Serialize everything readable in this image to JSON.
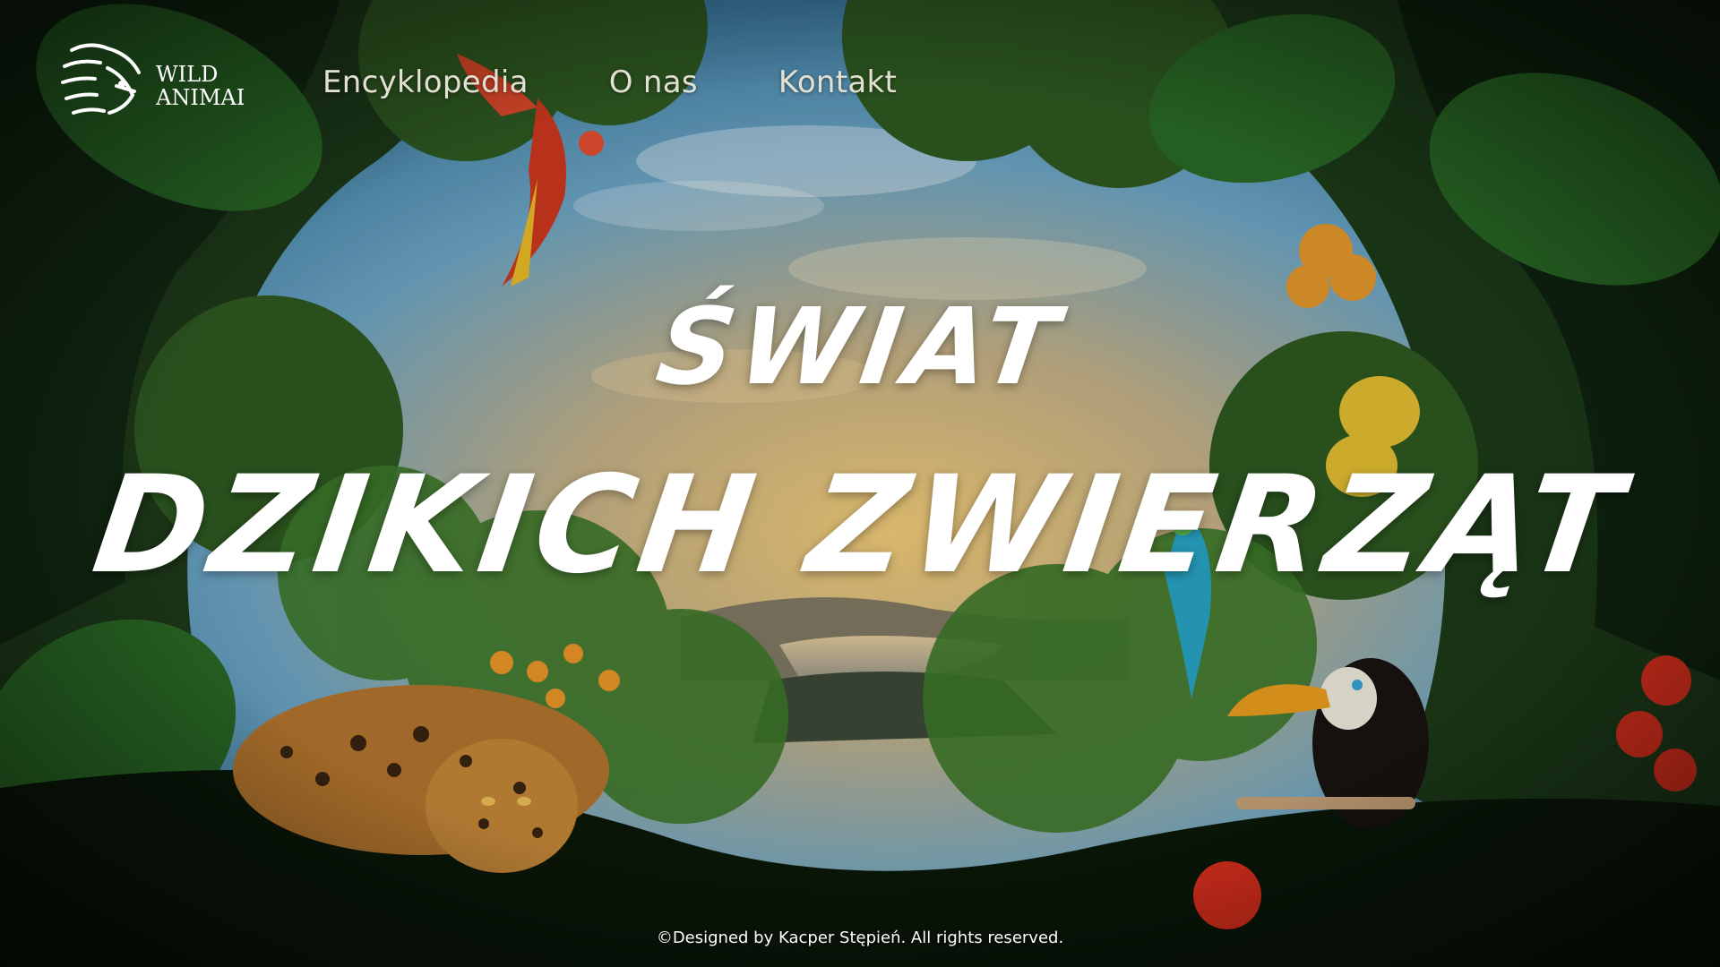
{
  "brand": {
    "line1": "WILD",
    "line2": "ANIMAL"
  },
  "nav": {
    "items": [
      "Encyklopedia",
      "O nas",
      "Kontakt"
    ]
  },
  "hero": {
    "line1": "ŚWIAT",
    "line2": "DZIKICH ZWIERZĄT"
  },
  "footer": {
    "text": "©Designed by Kacper Stępień. All rights reserved."
  },
  "colors": {
    "text": "#ffffff",
    "nav_text": "#e3e0d3",
    "jungle_dark": "#0c1a0c",
    "sky": "#7fb7d6",
    "sunset": "#f2c46c"
  },
  "icons": {
    "logo": "lion-icon"
  }
}
